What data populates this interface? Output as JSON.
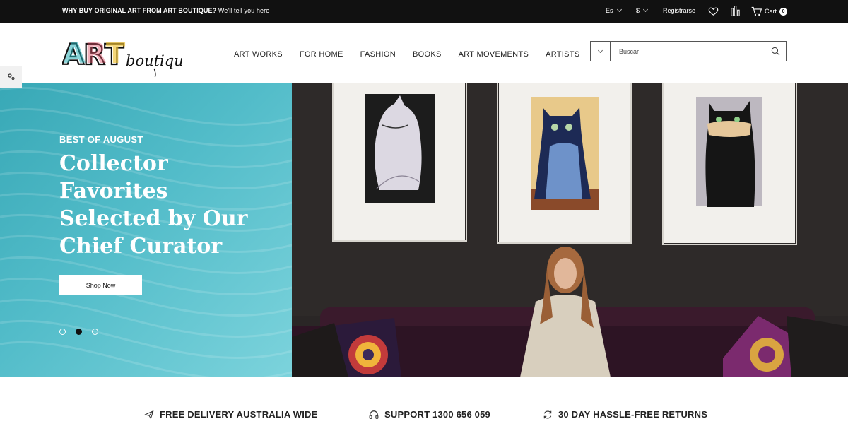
{
  "topbar": {
    "promo_bold": "WHY BUY ORIGINAL ART FROM ART BOUTIQUE?",
    "promo_text": "We'll tell you here",
    "language": "Es",
    "currency": "$",
    "register": "Registrarse",
    "cart_label": "Cart",
    "cart_count": "0"
  },
  "logo": {
    "art": "ART",
    "boutique": "boutique"
  },
  "nav": [
    "ART WORKS",
    "FOR HOME",
    "FASHION",
    "BOOKS",
    "ART MOVEMENTS",
    "ARTISTS"
  ],
  "search": {
    "placeholder": "Buscar"
  },
  "hero": {
    "eyebrow": "BEST OF AUGUST",
    "headline": "Collector Favorites Selected by Our Chief Curator",
    "button": "Shop Now",
    "slides": 3,
    "active_slide": 2
  },
  "features": [
    {
      "icon": "plane-icon",
      "text": "FREE DELIVERY AUSTRALIA WIDE"
    },
    {
      "icon": "headphones-icon",
      "text": "SUPPORT 1300 656 059"
    },
    {
      "icon": "refresh-icon",
      "text": "30 DAY HASSLE-FREE RETURNS"
    }
  ],
  "colors": {
    "topbar_bg": "#111111",
    "hero_teal": "#4bb5c2",
    "text_dark": "#222222"
  }
}
